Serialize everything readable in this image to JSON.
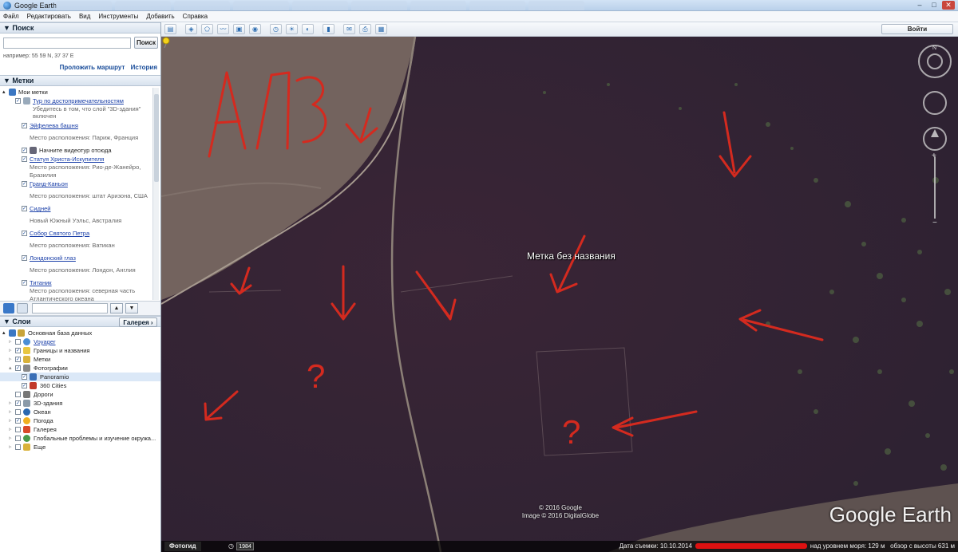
{
  "window": {
    "title": "Google Earth"
  },
  "menu": [
    "Файл",
    "Редактировать",
    "Вид",
    "Инструменты",
    "Добавить",
    "Справка"
  ],
  "toolbar": {
    "sign_in": "Войти"
  },
  "search": {
    "header": "Поиск",
    "button": "Поиск",
    "example": "например: 55 59 N, 37 37 E",
    "route_link": "Проложить маршрут",
    "history_link": "История"
  },
  "places": {
    "header": "Метки",
    "items": [
      {
        "label": "Мои метки",
        "sub": ""
      },
      {
        "label": "Тур по достопримечательностям",
        "sub": "Убедитесь в том, что слой \"3D-здания\" включен"
      },
      {
        "label": "Эйфелева башня",
        "sub": "Место расположения: Париж, Франция"
      },
      {
        "label": "Начните видеотур отсюда",
        "sub": ""
      },
      {
        "label": "Статуя Христа-Искупителя",
        "sub": "Место расположения: Рио-де-Жанейро, Бразилия"
      },
      {
        "label": "Гранд-Каньон",
        "sub": "Место расположения: штат Аризона, США"
      },
      {
        "label": "Сидней",
        "sub": "Новый Южный Уэльс, Австралия"
      },
      {
        "label": "Собор Святого Петра",
        "sub": "Место расположения: Ватикан"
      },
      {
        "label": "Лондонский глаз",
        "sub": "Место расположения: Лондон, Англия"
      },
      {
        "label": "Титаник",
        "sub": "Место расположения: северная часть Атлантического океана"
      }
    ]
  },
  "layers": {
    "header": "Слои",
    "gallery_button": "Галерея",
    "items": [
      "Основная база данных",
      "Voyager",
      "Границы и названия",
      "Метки",
      "Фотографии",
      "Panoramio",
      "360 Cities",
      "Дороги",
      "3D-здания",
      "Океан",
      "Погода",
      "Галерея",
      "Глобальные проблемы и изучение окружа...",
      "Еще"
    ]
  },
  "map": {
    "annotation_text": "АЛЗ",
    "placemark_label": "Метка без названия",
    "copyright_1": "© 2016 Google",
    "copyright_2": "Image © 2016 DigitalGlobe",
    "logo": "Google Earth",
    "question_mark": "?"
  },
  "status": {
    "tour_button": "Фотогид",
    "year": "1984",
    "date_label": "Дата съемки: 10.10.2014",
    "elevation": "над уровнем моря:   129 м",
    "eye_alt": "обзор с высоты   631 м"
  },
  "colors": {
    "annotation_red": "#d42a1f",
    "link_blue": "#1a3fa8"
  }
}
